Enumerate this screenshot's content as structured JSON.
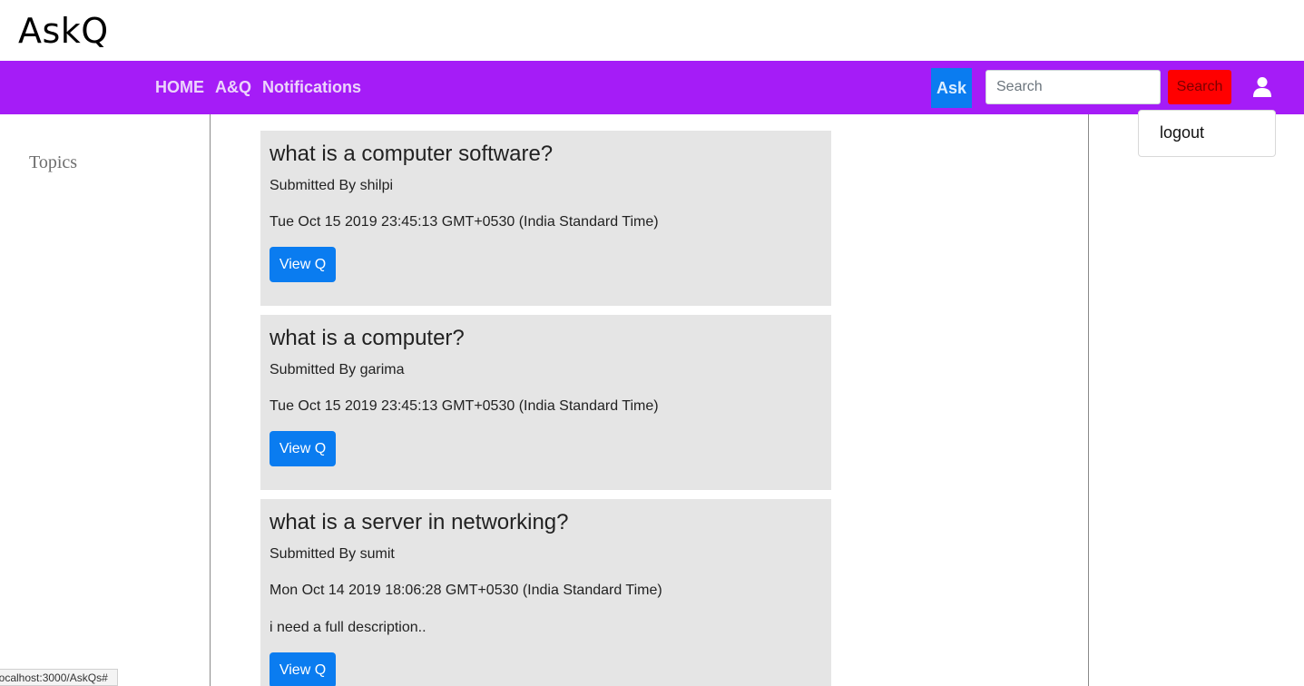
{
  "brand": "AskQ",
  "nav": {
    "links": [
      "HOME",
      "A&Q",
      "Notifications"
    ],
    "ask_label": "Ask",
    "search_placeholder": "Search",
    "search_button": "Search"
  },
  "user_menu": {
    "item": "logout"
  },
  "sidebar": {
    "title": "Topics"
  },
  "questions": [
    {
      "title": "what is a computer software?",
      "submitted": "Submitted By shilpi",
      "date": "Tue Oct 15 2019 23:45:13 GMT+0530 (India Standard Time)",
      "button": "View Q"
    },
    {
      "title": "what is a computer?",
      "submitted": "Submitted By garima",
      "date": "Tue Oct 15 2019 23:45:13 GMT+0530 (India Standard Time)",
      "button": "View Q"
    },
    {
      "title": "what is a server in networking?",
      "submitted": "Submitted By sumit",
      "date": "Mon Oct 14 2019 18:06:28 GMT+0530 (India Standard Time)",
      "description": "i need a full description..",
      "button": "View Q"
    }
  ],
  "status_bar": "localhost:3000/AskQs#",
  "colors": {
    "navbar": "#a51cf7",
    "primary_button": "#0a7cf0",
    "search_button": "#ff0000",
    "card_bg": "#e5e5e5"
  },
  "icons": {
    "user": "user-icon"
  }
}
